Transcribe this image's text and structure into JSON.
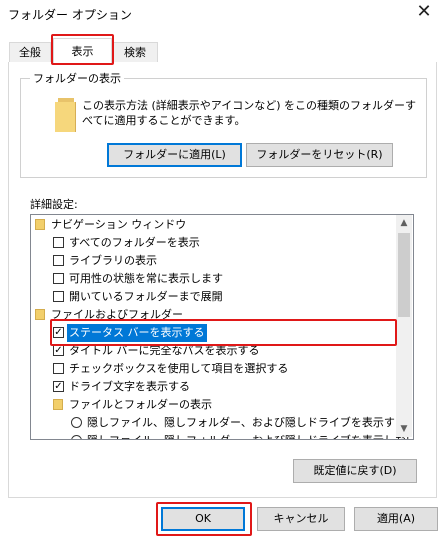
{
  "window": {
    "title": "フォルダー オプション",
    "close_glyph": "✕"
  },
  "tabs": [
    {
      "label": "全般"
    },
    {
      "label": "表示",
      "active": true
    },
    {
      "label": "検索"
    }
  ],
  "folder_views": {
    "legend": "フォルダーの表示",
    "description": "この表示方法 (詳細表示やアイコンなど) をこの種類のフォルダーすべてに適用することができます。",
    "apply_button": "フォルダーに適用(L)",
    "reset_button": "フォルダーをリセット(R)"
  },
  "advanced": {
    "label": "詳細設定:",
    "items": [
      {
        "kind": "folder",
        "level": 0,
        "label": "ナビゲーション ウィンドウ"
      },
      {
        "kind": "checkbox",
        "level": 1,
        "checked": false,
        "label": "すべてのフォルダーを表示"
      },
      {
        "kind": "checkbox",
        "level": 1,
        "checked": false,
        "label": "ライブラリの表示"
      },
      {
        "kind": "checkbox",
        "level": 1,
        "checked": false,
        "label": "可用性の状態を常に表示します"
      },
      {
        "kind": "checkbox",
        "level": 1,
        "checked": false,
        "label": "開いているフォルダーまで展開"
      },
      {
        "kind": "folder",
        "level": 0,
        "label": "ファイルおよびフォルダー"
      },
      {
        "kind": "checkbox",
        "level": 1,
        "checked": true,
        "selected": true,
        "label": "ステータス バーを表示する"
      },
      {
        "kind": "checkbox",
        "level": 1,
        "checked": true,
        "label": "タイトル バーに完全なパスを表示する"
      },
      {
        "kind": "checkbox",
        "level": 1,
        "checked": false,
        "label": "チェックボックスを使用して項目を選択する"
      },
      {
        "kind": "checkbox",
        "level": 1,
        "checked": true,
        "label": "ドライブ文字を表示する"
      },
      {
        "kind": "folder",
        "level": 1,
        "label": "ファイルとフォルダーの表示"
      },
      {
        "kind": "radio",
        "level": 2,
        "checked": false,
        "label": "隠しファイル、隠しフォルダー、および隠しドライブを表示する"
      },
      {
        "kind": "radio",
        "level": 2,
        "checked": false,
        "label": "隠しファイル、隠しフォルダー、および隠しドライブを表示しない"
      }
    ],
    "check_glyph": "✓"
  },
  "restore_defaults_button": "既定値に戻す(D)",
  "footer": {
    "ok": "OK",
    "cancel": "キャンセル",
    "apply": "適用(A)"
  },
  "scroll_glyphs": {
    "up": "▲",
    "down": "▼"
  },
  "colors": {
    "accent": "#0078d7",
    "highlight": "#e01818",
    "folder": "#f2cf6b"
  }
}
